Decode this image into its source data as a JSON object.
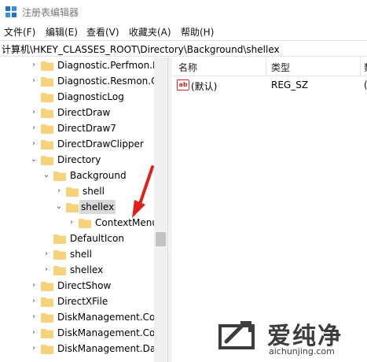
{
  "window": {
    "title": "注册表编辑器"
  },
  "menu": [
    {
      "label": "文件(F)"
    },
    {
      "label": "编辑(E)"
    },
    {
      "label": "查看(V)"
    },
    {
      "label": "收藏夹(A)"
    },
    {
      "label": "帮助(H)"
    }
  ],
  "address": {
    "path": "计算机\\HKEY_CLASSES_ROOT\\Directory\\Background\\shellex"
  },
  "tree": [
    {
      "label": "Diagnostic.Perfmon.D",
      "expander": "collapsed"
    },
    {
      "label": "Diagnostic.Resmon.C",
      "expander": "collapsed"
    },
    {
      "label": "DiagnosticLog",
      "expander": "none"
    },
    {
      "label": "DirectDraw",
      "expander": "collapsed"
    },
    {
      "label": "DirectDraw7",
      "expander": "collapsed"
    },
    {
      "label": "DirectDrawClipper",
      "expander": "collapsed"
    },
    {
      "label": "Directory",
      "expander": "expanded"
    },
    {
      "label": "Background",
      "expander": "expanded"
    },
    {
      "label": "shell",
      "expander": "collapsed"
    },
    {
      "label": "shellex",
      "expander": "expanded",
      "selected": true
    },
    {
      "label": "ContextMenu",
      "expander": "collapsed"
    },
    {
      "label": "DefaultIcon",
      "expander": "none"
    },
    {
      "label": "shell",
      "expander": "collapsed"
    },
    {
      "label": "shellex",
      "expander": "collapsed"
    },
    {
      "label": "DirectShow",
      "expander": "collapsed"
    },
    {
      "label": "DirectXFile",
      "expander": "collapsed"
    },
    {
      "label": "DiskManagement.Cor",
      "expander": "collapsed"
    },
    {
      "label": "DiskManagement.Cor",
      "expander": "collapsed"
    },
    {
      "label": "DiskManagement.Dat",
      "expander": "collapsed"
    }
  ],
  "list": {
    "columns": [
      {
        "label": "名称"
      },
      {
        "label": "类型"
      },
      {
        "label": "数"
      }
    ],
    "rows": [
      {
        "name": "(默认)",
        "type": "REG_SZ",
        "icon": "ab",
        "data": "("
      }
    ]
  },
  "watermark": {
    "title": "爱纯净",
    "url": "aichunjing.com"
  },
  "colors": {
    "annotation_arrow": "#e0201b",
    "folder": "#f5d37b",
    "selection": "#d9d9d9"
  }
}
